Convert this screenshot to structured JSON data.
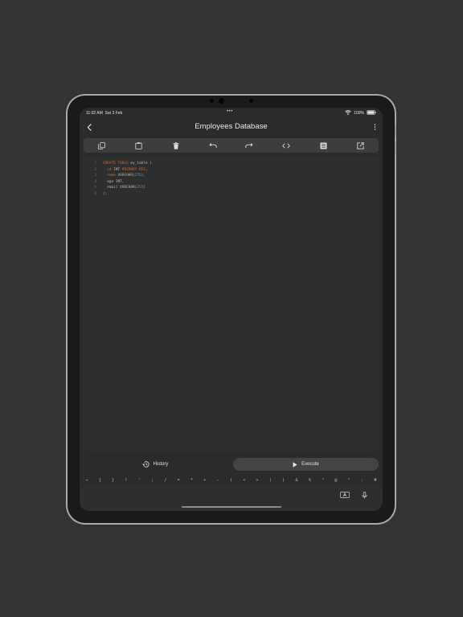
{
  "status_bar": {
    "time": "11:02 AM",
    "date": "Sat 3 Feb",
    "battery": "100%"
  },
  "header": {
    "title": "Employees Database"
  },
  "toolbar": {
    "buttons": [
      {
        "name": "copy",
        "icon": "copy-icon"
      },
      {
        "name": "paste",
        "icon": "clipboard-icon"
      },
      {
        "name": "delete",
        "icon": "trash-icon"
      },
      {
        "name": "undo",
        "icon": "undo-icon"
      },
      {
        "name": "redo",
        "icon": "redo-icon"
      },
      {
        "name": "format",
        "icon": "code-icon"
      },
      {
        "name": "table",
        "icon": "table-icon"
      },
      {
        "name": "export",
        "icon": "external-link-icon"
      }
    ]
  },
  "editor": {
    "lines": [
      {
        "n": "1",
        "a": "CREATE TABLE",
        "b": " my_table (",
        "c": ""
      },
      {
        "n": "2",
        "a": "  id",
        "b": " INT",
        "c": " PRIMARY KEY",
        "d": ","
      },
      {
        "n": "3",
        "a": "  name",
        "b": " VARCHAR(",
        "c": "255",
        "d": "),"
      },
      {
        "n": "4",
        "a": "  age INT,",
        "b": "",
        "c": ""
      },
      {
        "n": "5",
        "a": "  email VARCHAR(",
        "b": "255",
        "c": ")"
      },
      {
        "n": "6",
        "a": ");",
        "b": "",
        "c": ""
      }
    ]
  },
  "actions": {
    "history_label": "History",
    "execute_label": "Execute"
  },
  "keyboard": {
    "symbols": [
      "→",
      "{",
      "}",
      "!",
      "'",
      ";",
      "/",
      "=",
      "*",
      "+",
      "-",
      ")",
      "<",
      ">",
      "(",
      ")",
      "&",
      "%",
      "\"",
      "@",
      "\"",
      ":",
      "#"
    ]
  },
  "colors": {
    "keyword": "#c1703a",
    "number": "#7494b4",
    "text": "#b8b8b8",
    "background": "#333333"
  }
}
